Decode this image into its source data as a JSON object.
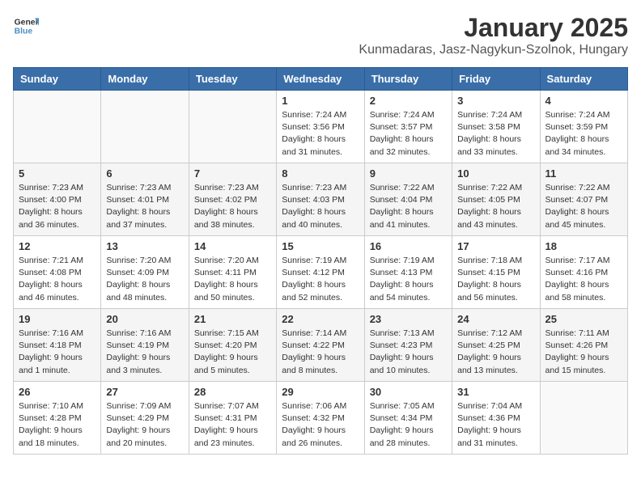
{
  "header": {
    "logo_general": "General",
    "logo_blue": "Blue",
    "month": "January 2025",
    "location": "Kunmadaras, Jasz-Nagykun-Szolnok, Hungary"
  },
  "weekdays": [
    "Sunday",
    "Monday",
    "Tuesday",
    "Wednesday",
    "Thursday",
    "Friday",
    "Saturday"
  ],
  "weeks": [
    [
      {
        "day": "",
        "detail": ""
      },
      {
        "day": "",
        "detail": ""
      },
      {
        "day": "",
        "detail": ""
      },
      {
        "day": "1",
        "detail": "Sunrise: 7:24 AM\nSunset: 3:56 PM\nDaylight: 8 hours and 31 minutes."
      },
      {
        "day": "2",
        "detail": "Sunrise: 7:24 AM\nSunset: 3:57 PM\nDaylight: 8 hours and 32 minutes."
      },
      {
        "day": "3",
        "detail": "Sunrise: 7:24 AM\nSunset: 3:58 PM\nDaylight: 8 hours and 33 minutes."
      },
      {
        "day": "4",
        "detail": "Sunrise: 7:24 AM\nSunset: 3:59 PM\nDaylight: 8 hours and 34 minutes."
      }
    ],
    [
      {
        "day": "5",
        "detail": "Sunrise: 7:23 AM\nSunset: 4:00 PM\nDaylight: 8 hours and 36 minutes."
      },
      {
        "day": "6",
        "detail": "Sunrise: 7:23 AM\nSunset: 4:01 PM\nDaylight: 8 hours and 37 minutes."
      },
      {
        "day": "7",
        "detail": "Sunrise: 7:23 AM\nSunset: 4:02 PM\nDaylight: 8 hours and 38 minutes."
      },
      {
        "day": "8",
        "detail": "Sunrise: 7:23 AM\nSunset: 4:03 PM\nDaylight: 8 hours and 40 minutes."
      },
      {
        "day": "9",
        "detail": "Sunrise: 7:22 AM\nSunset: 4:04 PM\nDaylight: 8 hours and 41 minutes."
      },
      {
        "day": "10",
        "detail": "Sunrise: 7:22 AM\nSunset: 4:05 PM\nDaylight: 8 hours and 43 minutes."
      },
      {
        "day": "11",
        "detail": "Sunrise: 7:22 AM\nSunset: 4:07 PM\nDaylight: 8 hours and 45 minutes."
      }
    ],
    [
      {
        "day": "12",
        "detail": "Sunrise: 7:21 AM\nSunset: 4:08 PM\nDaylight: 8 hours and 46 minutes."
      },
      {
        "day": "13",
        "detail": "Sunrise: 7:20 AM\nSunset: 4:09 PM\nDaylight: 8 hours and 48 minutes."
      },
      {
        "day": "14",
        "detail": "Sunrise: 7:20 AM\nSunset: 4:11 PM\nDaylight: 8 hours and 50 minutes."
      },
      {
        "day": "15",
        "detail": "Sunrise: 7:19 AM\nSunset: 4:12 PM\nDaylight: 8 hours and 52 minutes."
      },
      {
        "day": "16",
        "detail": "Sunrise: 7:19 AM\nSunset: 4:13 PM\nDaylight: 8 hours and 54 minutes."
      },
      {
        "day": "17",
        "detail": "Sunrise: 7:18 AM\nSunset: 4:15 PM\nDaylight: 8 hours and 56 minutes."
      },
      {
        "day": "18",
        "detail": "Sunrise: 7:17 AM\nSunset: 4:16 PM\nDaylight: 8 hours and 58 minutes."
      }
    ],
    [
      {
        "day": "19",
        "detail": "Sunrise: 7:16 AM\nSunset: 4:18 PM\nDaylight: 9 hours and 1 minute."
      },
      {
        "day": "20",
        "detail": "Sunrise: 7:16 AM\nSunset: 4:19 PM\nDaylight: 9 hours and 3 minutes."
      },
      {
        "day": "21",
        "detail": "Sunrise: 7:15 AM\nSunset: 4:20 PM\nDaylight: 9 hours and 5 minutes."
      },
      {
        "day": "22",
        "detail": "Sunrise: 7:14 AM\nSunset: 4:22 PM\nDaylight: 9 hours and 8 minutes."
      },
      {
        "day": "23",
        "detail": "Sunrise: 7:13 AM\nSunset: 4:23 PM\nDaylight: 9 hours and 10 minutes."
      },
      {
        "day": "24",
        "detail": "Sunrise: 7:12 AM\nSunset: 4:25 PM\nDaylight: 9 hours and 13 minutes."
      },
      {
        "day": "25",
        "detail": "Sunrise: 7:11 AM\nSunset: 4:26 PM\nDaylight: 9 hours and 15 minutes."
      }
    ],
    [
      {
        "day": "26",
        "detail": "Sunrise: 7:10 AM\nSunset: 4:28 PM\nDaylight: 9 hours and 18 minutes."
      },
      {
        "day": "27",
        "detail": "Sunrise: 7:09 AM\nSunset: 4:29 PM\nDaylight: 9 hours and 20 minutes."
      },
      {
        "day": "28",
        "detail": "Sunrise: 7:07 AM\nSunset: 4:31 PM\nDaylight: 9 hours and 23 minutes."
      },
      {
        "day": "29",
        "detail": "Sunrise: 7:06 AM\nSunset: 4:32 PM\nDaylight: 9 hours and 26 minutes."
      },
      {
        "day": "30",
        "detail": "Sunrise: 7:05 AM\nSunset: 4:34 PM\nDaylight: 9 hours and 28 minutes."
      },
      {
        "day": "31",
        "detail": "Sunrise: 7:04 AM\nSunset: 4:36 PM\nDaylight: 9 hours and 31 minutes."
      },
      {
        "day": "",
        "detail": ""
      }
    ]
  ]
}
